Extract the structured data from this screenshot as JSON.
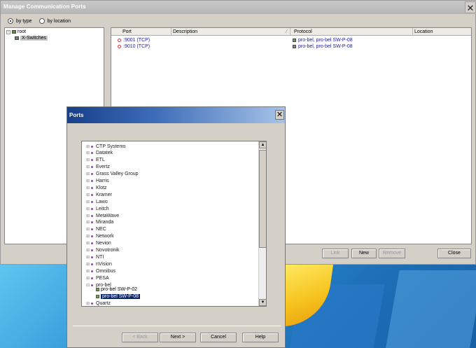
{
  "main_window": {
    "title": "Manage Communication Ports",
    "view_options": [
      {
        "label": "by type",
        "selected": true
      },
      {
        "label": "by location",
        "selected": false
      }
    ],
    "tree": {
      "root": "root",
      "child": "X-Switches"
    },
    "columns": [
      "Port",
      "Description",
      "Protocol",
      "Location"
    ],
    "rows": [
      {
        "port": ":9001 (TCP)",
        "description": "",
        "protocol": "pro-bel, pro-bel SW-P-08",
        "location": ""
      },
      {
        "port": ":9010 (TCP)",
        "description": "",
        "protocol": "pro-bel, pro-bel SW-P-08",
        "location": ""
      }
    ],
    "buttons": {
      "link": "Link",
      "new": "New",
      "remove": "Remove",
      "close": "Close"
    },
    "close_glyph": "✕"
  },
  "ports_dialog": {
    "title": "Ports",
    "close_glyph": "✕",
    "vendors": [
      "CTP Systems",
      "Datatek",
      "ETL",
      "Evertz",
      "Grass Valley Group",
      "Harris",
      "Klotz",
      "Kramer",
      "Lawo",
      "Leitch",
      "MetaWave",
      "Miranda",
      "NEC",
      "Network",
      "Nevion",
      "Novotronik",
      "NTI",
      "nVision",
      "Omnibus",
      "PESA",
      "pro-bel"
    ],
    "probel_children": [
      "pro-bel SW-P-02",
      "pro-bel SW-P-08"
    ],
    "selected_child": "pro-bel SW-P-08",
    "last_vendor": "Quartz",
    "buttons": {
      "back": "< Back",
      "next": "Next >",
      "cancel": "Cancel",
      "help": "Help"
    }
  },
  "colors": {
    "dialog_title_start": "#173f8a",
    "selection": "#0a246a",
    "link_text": "#1a1aa6"
  }
}
